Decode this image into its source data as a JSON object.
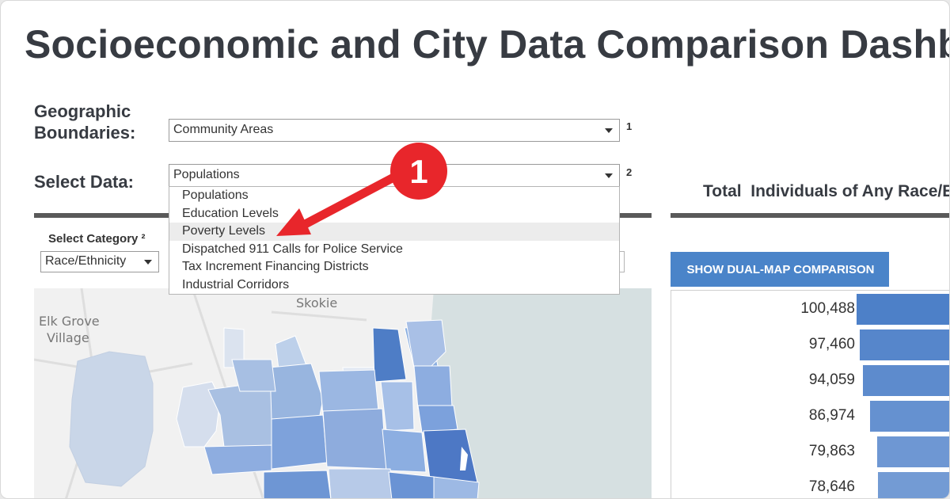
{
  "page": {
    "title": "Socioeconomic and City Data Comparison Dashboard"
  },
  "controls": {
    "geo_label": "Geographic Boundaries:",
    "geo_value": "Community Areas",
    "geo_footnote": "1",
    "data_label": "Select Data:",
    "data_value": "Populations",
    "data_footnote": "2",
    "data_options": [
      "Populations",
      "Education Levels",
      "Poverty Levels",
      "Dispatched 911 Calls for Police Service",
      "Tax Increment Financing Districts",
      "Industrial Corridors"
    ],
    "hovered_option": "Poverty Levels",
    "category_label": "Select Category ²",
    "category_value": "Race/Ethnicity"
  },
  "panel": {
    "title": "Total  Individuals of Any Race/Ethnicity",
    "dual_map_button": "SHOW DUAL-MAP COMPARISON"
  },
  "map": {
    "labels": [
      "Skokie",
      "Elk Grove",
      "Village"
    ]
  },
  "chart_data": {
    "type": "bar",
    "orientation": "horizontal",
    "values": [
      100488,
      97460,
      94059,
      86974,
      79863,
      78646
    ],
    "value_labels": [
      "100,488",
      "97,460",
      "94,059",
      "86,974",
      "79,863",
      "78,646"
    ],
    "colors": [
      "#4d80c8",
      "#5686cb",
      "#5d8bcd",
      "#6591d0",
      "#6e97d3",
      "#739bd4"
    ]
  },
  "callout": {
    "number": "1",
    "color": "#e8262b"
  }
}
